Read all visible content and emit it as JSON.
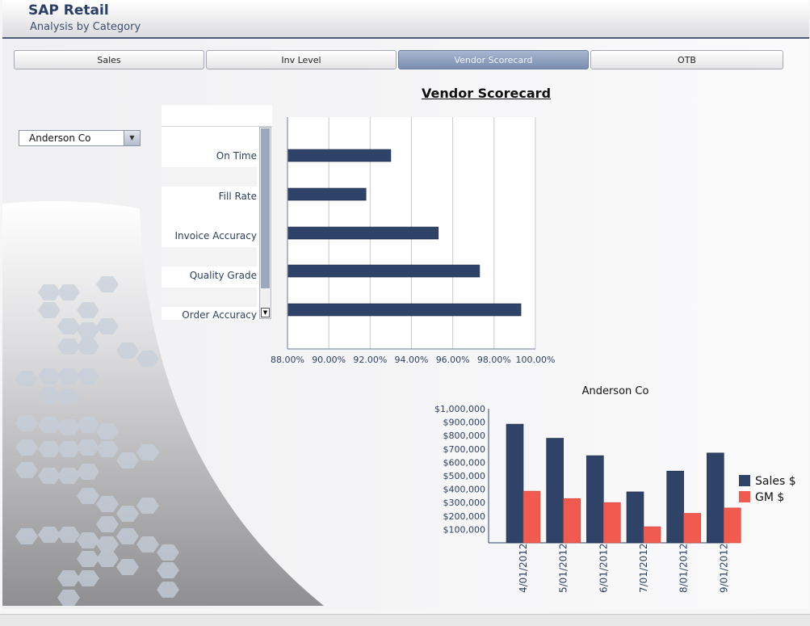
{
  "header": {
    "title": "SAP Retail",
    "subtitle": "Analysis by Category"
  },
  "tabs": [
    {
      "label": "Sales",
      "active": false
    },
    {
      "label": "Inv Level",
      "active": false
    },
    {
      "label": "Vendor Scorecard",
      "active": true
    },
    {
      "label": "OTB",
      "active": false
    }
  ],
  "vendor_select": {
    "value": "Anderson Co"
  },
  "scorecard": {
    "title": "Vendor Scorecard"
  },
  "comparison": {
    "title": "Anderson Co"
  },
  "colors": {
    "bar": "#2f4368",
    "sales": "#2f4368",
    "gm": "#f05a4f",
    "accent": "#7b8eb0"
  },
  "icons": {
    "dropdown": "chevron-down-icon",
    "scroll_down": "scroll-down-arrow-icon"
  },
  "chart_data": [
    {
      "type": "bar",
      "orientation": "horizontal",
      "title": "Vendor Scorecard",
      "categories": [
        "On Time",
        "Fill Rate",
        "Invoice Accuracy",
        "Quality Grade",
        "Order Accuracy"
      ],
      "values": [
        93.0,
        91.8,
        95.3,
        97.3,
        99.3
      ],
      "xlim": [
        88,
        100
      ],
      "tick_labels": [
        "88.00%",
        "90.00%",
        "92.00%",
        "94.00%",
        "96.00%",
        "98.00%",
        "100.00%"
      ],
      "grid": true
    },
    {
      "type": "bar",
      "title": "Anderson Co",
      "categories": [
        "4/01/2012",
        "5/01/2012",
        "6/01/2012",
        "7/01/2012",
        "8/01/2012",
        "9/01/2012"
      ],
      "series": [
        {
          "name": "Sales $",
          "values": [
            885000,
            780000,
            650000,
            380000,
            535000,
            670000
          ]
        },
        {
          "name": "GM $",
          "values": [
            385000,
            330000,
            300000,
            120000,
            220000,
            260000
          ]
        }
      ],
      "ylim": [
        0,
        1000000
      ],
      "tick_labels": [
        "$100,000",
        "$200,000",
        "$300,000",
        "$400,000",
        "$500,000",
        "$600,000",
        "$700,000",
        "$800,000",
        "$900,000",
        "$1,000,000"
      ],
      "legend": "right"
    }
  ]
}
